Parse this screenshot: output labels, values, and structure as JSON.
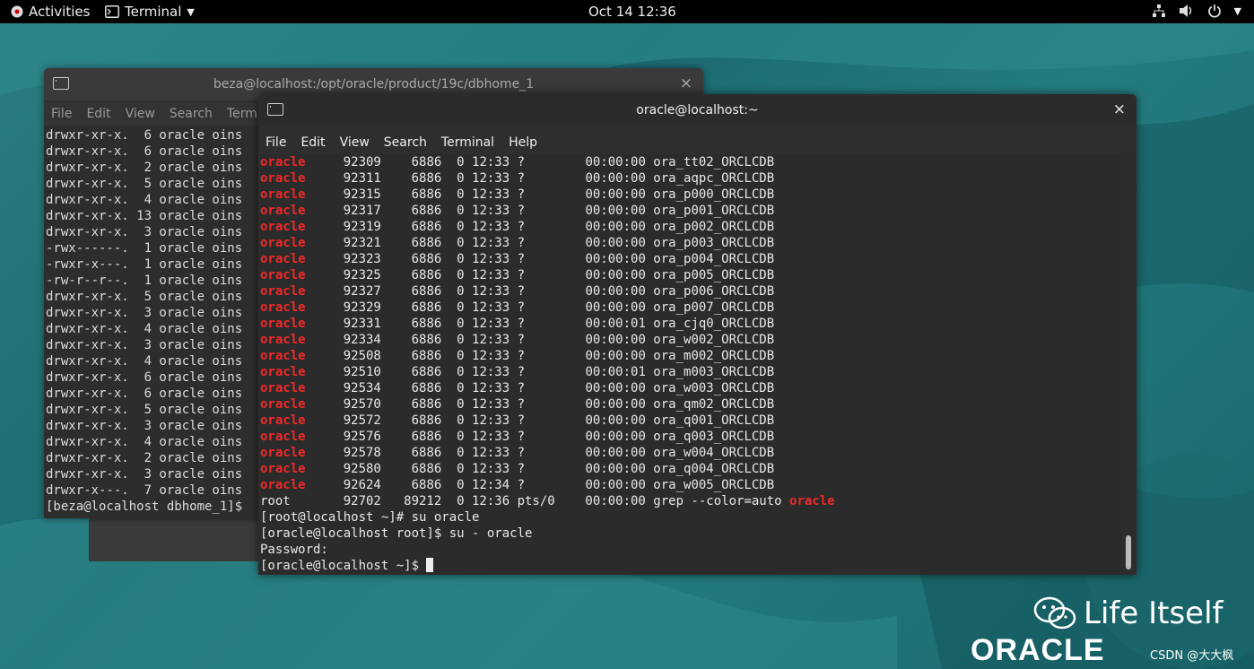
{
  "topbar": {
    "activities": "Activities",
    "app": "Terminal",
    "clock": "Oct 14  12:36"
  },
  "back_window": {
    "title": "beza@localhost:/opt/oracle/product/19c/dbhome_1",
    "menu": [
      "File",
      "Edit",
      "View",
      "Search",
      "Termin"
    ],
    "lines": [
      "drwxr-xr-x.  6 oracle oins",
      "drwxr-xr-x.  6 oracle oins",
      "drwxr-xr-x.  2 oracle oins",
      "drwxr-xr-x.  5 oracle oins",
      "drwxr-xr-x.  4 oracle oins",
      "drwxr-xr-x. 13 oracle oins",
      "drwxr-xr-x.  3 oracle oins",
      "-rwx------.  1 oracle oins",
      "-rwxr-x---.  1 oracle oins",
      "-rw-r--r--.  1 oracle oins",
      "drwxr-xr-x.  5 oracle oins",
      "drwxr-xr-x.  3 oracle oins",
      "drwxr-xr-x.  4 oracle oins",
      "drwxr-xr-x.  3 oracle oins",
      "drwxr-xr-x.  4 oracle oins",
      "drwxr-xr-x.  6 oracle oins",
      "drwxr-xr-x.  6 oracle oins",
      "drwxr-xr-x.  5 oracle oins",
      "drwxr-xr-x.  3 oracle oins",
      "drwxr-xr-x.  4 oracle oins",
      "drwxr-xr-x.  2 oracle oins",
      "drwxr-xr-x.  3 oracle oins",
      "drwxr-x---.  7 oracle oins",
      "[beza@localhost dbhome_1]$"
    ]
  },
  "front_window": {
    "title": "oracle@localhost:~",
    "menu": [
      "File",
      "Edit",
      "View",
      "Search",
      "Terminal",
      "Help"
    ],
    "ps_rows": [
      {
        "user": "oracle",
        "rest": "     92309    6886  0 12:33 ?        00:00:00 ora_tt02_ORCLCDB"
      },
      {
        "user": "oracle",
        "rest": "     92311    6886  0 12:33 ?        00:00:00 ora_aqpc_ORCLCDB"
      },
      {
        "user": "oracle",
        "rest": "     92315    6886  0 12:33 ?        00:00:00 ora_p000_ORCLCDB"
      },
      {
        "user": "oracle",
        "rest": "     92317    6886  0 12:33 ?        00:00:00 ora_p001_ORCLCDB"
      },
      {
        "user": "oracle",
        "rest": "     92319    6886  0 12:33 ?        00:00:00 ora_p002_ORCLCDB"
      },
      {
        "user": "oracle",
        "rest": "     92321    6886  0 12:33 ?        00:00:00 ora_p003_ORCLCDB"
      },
      {
        "user": "oracle",
        "rest": "     92323    6886  0 12:33 ?        00:00:00 ora_p004_ORCLCDB"
      },
      {
        "user": "oracle",
        "rest": "     92325    6886  0 12:33 ?        00:00:00 ora_p005_ORCLCDB"
      },
      {
        "user": "oracle",
        "rest": "     92327    6886  0 12:33 ?        00:00:00 ora_p006_ORCLCDB"
      },
      {
        "user": "oracle",
        "rest": "     92329    6886  0 12:33 ?        00:00:00 ora_p007_ORCLCDB"
      },
      {
        "user": "oracle",
        "rest": "     92331    6886  0 12:33 ?        00:00:01 ora_cjq0_ORCLCDB"
      },
      {
        "user": "oracle",
        "rest": "     92334    6886  0 12:33 ?        00:00:00 ora_w002_ORCLCDB"
      },
      {
        "user": "oracle",
        "rest": "     92508    6886  0 12:33 ?        00:00:00 ora_m002_ORCLCDB"
      },
      {
        "user": "oracle",
        "rest": "     92510    6886  0 12:33 ?        00:00:01 ora_m003_ORCLCDB"
      },
      {
        "user": "oracle",
        "rest": "     92534    6886  0 12:33 ?        00:00:00 ora_w003_ORCLCDB"
      },
      {
        "user": "oracle",
        "rest": "     92570    6886  0 12:33 ?        00:00:00 ora_qm02_ORCLCDB"
      },
      {
        "user": "oracle",
        "rest": "     92572    6886  0 12:33 ?        00:00:00 ora_q001_ORCLCDB"
      },
      {
        "user": "oracle",
        "rest": "     92576    6886  0 12:33 ?        00:00:00 ora_q003_ORCLCDB"
      },
      {
        "user": "oracle",
        "rest": "     92578    6886  0 12:33 ?        00:00:00 ora_w004_ORCLCDB"
      },
      {
        "user": "oracle",
        "rest": "     92580    6886  0 12:33 ?        00:00:00 ora_q004_ORCLCDB"
      },
      {
        "user": "oracle",
        "rest": "     92624    6886  0 12:34 ?        00:00:00 ora_w005_ORCLCDB"
      }
    ],
    "grep_line": {
      "prefix": "root       92702   89212  0 12:36 pts/0    00:00:00 grep --color=auto ",
      "match": "oracle"
    },
    "after_lines": [
      "[root@localhost ~]# su oracle",
      "[oracle@localhost root]$ su - oracle",
      "Password:"
    ],
    "prompt": "[oracle@localhost ~]$ "
  },
  "watermark": {
    "text": "Life Itself",
    "logo": "ORACLE",
    "credit": "CSDN @大大枫"
  },
  "colors": {
    "highlight": "#ef2929",
    "terminal_bg": "#2b2b2b",
    "desktop": "#1d6f73"
  }
}
